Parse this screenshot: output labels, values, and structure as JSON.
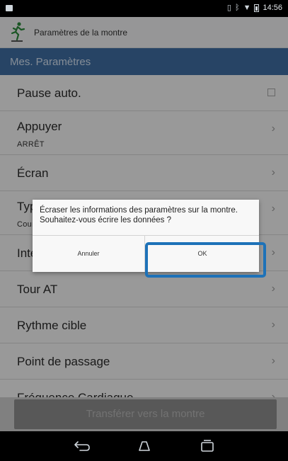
{
  "status_bar": {
    "time": "14:56",
    "icons": [
      "notification-icon",
      "bluetooth-icon",
      "wifi-icon",
      "battery-icon"
    ]
  },
  "action_bar": {
    "title": "Paramètres de la montre",
    "logo_icon": "runner-icon"
  },
  "section_header": "Mes. Paramètres",
  "settings": [
    {
      "label": "Pause auto.",
      "control": "checkbox"
    },
    {
      "label": "Appuyer",
      "sub": "ARRÊT",
      "control": "chevron"
    },
    {
      "label": "Écran",
      "control": "chevron"
    },
    {
      "label": "Type d'activité",
      "sub": "Course",
      "control": "chevron"
    },
    {
      "label": "Intervalle",
      "control": "chevron"
    },
    {
      "label": "Tour AT",
      "control": "chevron"
    },
    {
      "label": "Rythme cible",
      "control": "chevron"
    },
    {
      "label": "Point de passage",
      "control": "chevron"
    },
    {
      "label": "Fréquence Cardiaque",
      "control": "chevron"
    }
  ],
  "transfer_button": "Transférer vers la montre",
  "dialog": {
    "message": "Écraser les informations des paramètres sur la montre. Souhaitez-vous écrire les données ?",
    "cancel_label": "Annuler",
    "ok_label": "OK"
  },
  "colors": {
    "header_blue": "#3f6fa4",
    "highlight_blue": "#1e72b8"
  },
  "nav_bar": {
    "icons": [
      "back-icon",
      "home-icon",
      "recent-apps-icon"
    ]
  }
}
